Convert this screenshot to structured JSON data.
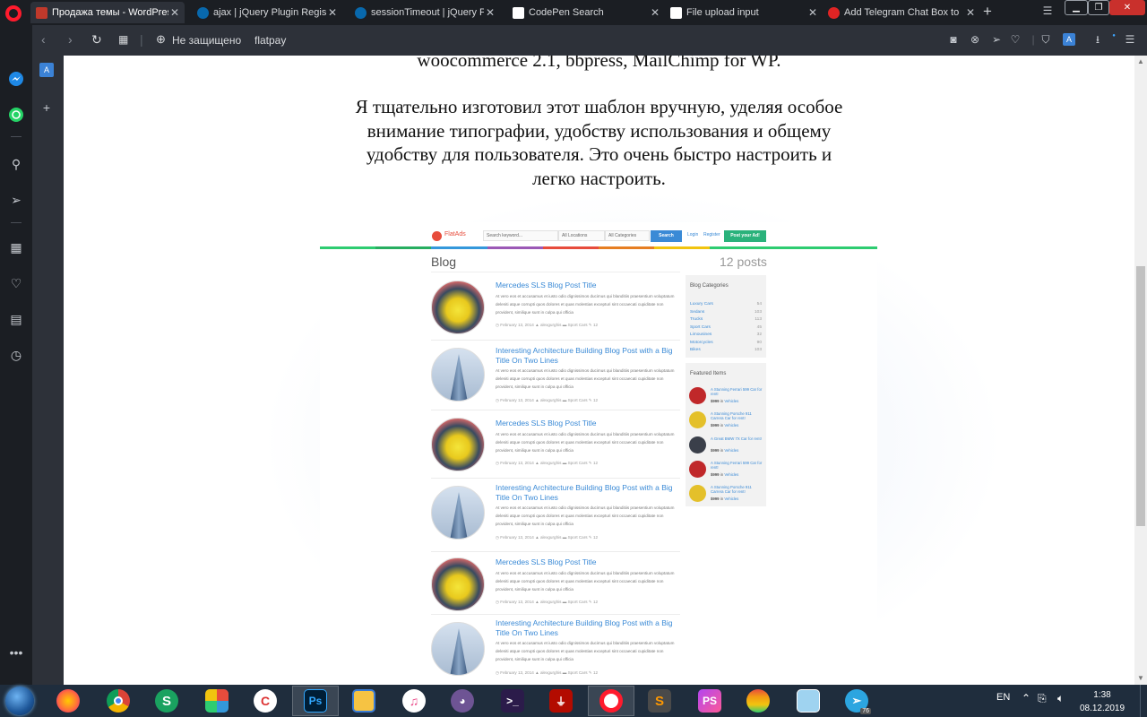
{
  "browser": {
    "tabs": [
      {
        "label": "Продажа темы - WordPress",
        "active": true
      },
      {
        "label": "ajax | jQuery Plugin Registry",
        "active": false
      },
      {
        "label": "sessionTimeout | jQuery Plugin",
        "active": false
      },
      {
        "label": "CodePen Search",
        "active": false
      },
      {
        "label": "File upload input",
        "active": false
      },
      {
        "label": "Add Telegram Chat Box to",
        "active": false
      }
    ],
    "address": {
      "security_label": "Не защищено",
      "url": "flatpay"
    },
    "colors": {
      "tabbar": "#1b1e23",
      "toolbar": "#2d3139",
      "opera_red": "#ff1b2d"
    }
  },
  "page": {
    "text_top": "woocommerce 2.1, bbpress, MailChimp for WP.",
    "paragraph": [
      "Я тщательно изготовил этот шаблон вручную, уделяя особое",
      "внимание типографии, удобству использования и общему",
      "удобству для пользователя. Это очень быстро настроить и",
      "легко настроить."
    ]
  },
  "preview": {
    "brand": "FlatAds",
    "search_placeholder": "Search keyword...",
    "locations": "All Locations",
    "categories": "All Categories",
    "search_btn": "Search",
    "login": "Login",
    "register": "Register",
    "post_ad": "Post your Ad!",
    "blog_title": "Blog",
    "posts_count": "12 posts",
    "posts": [
      {
        "title": "Mercedes SLS Blog Post Title",
        "type": "car"
      },
      {
        "title": "Interesting Architecture Building Blog Post with a Big Title On Two Lines",
        "type": "tower"
      },
      {
        "title": "Mercedes SLS Blog Post Title",
        "type": "car"
      },
      {
        "title": "Interesting Architecture Building Blog Post with a Big Title On Two Lines",
        "type": "tower"
      },
      {
        "title": "Mercedes SLS Blog Post Title",
        "type": "car"
      },
      {
        "title": "Interesting Architecture Building Blog Post with a Big Title On Two Lines",
        "type": "tower"
      }
    ],
    "excerpt": "At vero eos et accusamus et iusto odio dignissimos ducimus qui blanditiis praesentium voluptatum deleniti atque corrupti quos dolores et quas molestias excepturi sint occaecati cupiditate non provident, similique sunt in culpa qui officia",
    "meta": {
      "date": "February 13, 2014",
      "author": "alexgurghis",
      "category": "Sport Cars",
      "comments": "12"
    },
    "sidebar_categories_title": "Blog Categories",
    "blog_categories": [
      {
        "name": "Luxury Cars",
        "count": "54"
      },
      {
        "name": "Sedans",
        "count": "103"
      },
      {
        "name": "Trucks",
        "count": "113"
      },
      {
        "name": "Sport Cars",
        "count": "45"
      },
      {
        "name": "Limousines",
        "count": "32"
      },
      {
        "name": "Motorcycles",
        "count": "90"
      },
      {
        "name": "Bikes",
        "count": "103"
      }
    ],
    "featured_title": "Featured Items",
    "featured": [
      {
        "title": "A Stunning Ferrari 599 Car for rent!",
        "price": "$999",
        "cat": "Vehicles",
        "color": "#c0282a"
      },
      {
        "title": "A Stunning Porsche 911 Carrera Car for rent!",
        "price": "$999",
        "cat": "Vehicles",
        "color": "#e4c02a"
      },
      {
        "title": "A Great BMW 7X Car for rent!",
        "price": "$999",
        "cat": "Vehicles",
        "color": "#3a3f4a"
      },
      {
        "title": "A Stunning Ferrari 599 Car for rent!",
        "price": "$999",
        "cat": "Vehicles",
        "color": "#c0282a"
      },
      {
        "title": "A Stunning Porsche 911 Carrera Car for rent!",
        "price": "$999",
        "cat": "Vehicles",
        "color": "#e4c02a"
      }
    ],
    "in_label": "in",
    "colors": {
      "accent_blue": "#3a8ad6",
      "post_green": "#2ab27b",
      "brand_red": "#e74c3c"
    }
  },
  "taskbar": {
    "apps": [
      "Firefox",
      "Chrome",
      "S",
      "Apps",
      "CCleaner",
      "Ps",
      "Files",
      "iTunes",
      "GitHub",
      "Terminal",
      "PDF",
      "Opera",
      "Sublime",
      "PhpStorm",
      "Rainbow",
      "Notes",
      "Telegram"
    ],
    "language": "EN",
    "time": "1:38",
    "date": "08.12.2019",
    "telegram_badge": "76"
  }
}
